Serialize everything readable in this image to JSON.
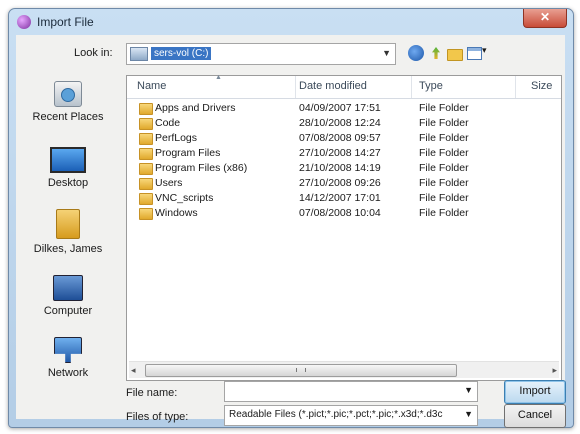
{
  "window": {
    "title": "Import File",
    "close_glyph": "✕"
  },
  "look_in": {
    "label": "Look in:",
    "value": "sers-vol (C:)",
    "drive_icon": "local-disk-icon"
  },
  "toolbar": [
    "back-icon",
    "up-folder-icon",
    "new-folder-icon",
    "views-menu-icon"
  ],
  "places": [
    {
      "label": "Recent Places",
      "icon": "recent-places-icon"
    },
    {
      "label": "Desktop",
      "icon": "desktop-icon"
    },
    {
      "label": "Dilkes, James",
      "icon": "user-folder-icon"
    },
    {
      "label": "Computer",
      "icon": "computer-icon"
    },
    {
      "label": "Network",
      "icon": "network-icon"
    }
  ],
  "columns": {
    "name": "Name",
    "date": "Date modified",
    "type": "Type",
    "size": "Size"
  },
  "files": [
    {
      "name": "Apps and Drivers",
      "date": "04/09/2007 17:51",
      "type": "File Folder"
    },
    {
      "name": "Code",
      "date": "28/10/2008 12:24",
      "type": "File Folder"
    },
    {
      "name": "PerfLogs",
      "date": "07/08/2008 09:57",
      "type": "File Folder"
    },
    {
      "name": "Program Files",
      "date": "27/10/2008 14:27",
      "type": "File Folder"
    },
    {
      "name": "Program Files (x86)",
      "date": "21/10/2008 14:19",
      "type": "File Folder"
    },
    {
      "name": "Users",
      "date": "27/10/2008 09:26",
      "type": "File Folder"
    },
    {
      "name": "VNC_scripts",
      "date": "14/12/2007 17:01",
      "type": "File Folder"
    },
    {
      "name": "Windows",
      "date": "07/08/2008 10:04",
      "type": "File Folder"
    }
  ],
  "file_name": {
    "label": "File name:",
    "value": ""
  },
  "file_type": {
    "label": "Files of type:",
    "value": "Readable Files (*.pict;*.pic;*.pct;*.pic;*.x3d;*.d3c"
  },
  "buttons": {
    "import": "Import",
    "cancel": "Cancel"
  }
}
